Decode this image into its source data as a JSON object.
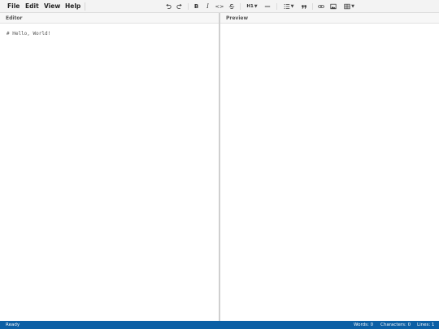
{
  "menu": [
    {
      "label": "File"
    },
    {
      "label": "Edit"
    },
    {
      "label": "View"
    },
    {
      "label": "Help"
    }
  ],
  "toolbar": {
    "bold": "B",
    "italic": "I",
    "code": "<>",
    "heading": "H1",
    "icons": [
      "undo-icon",
      "redo-icon",
      "bold-icon",
      "italic-icon",
      "code-icon",
      "strikethrough-icon",
      "heading-icon",
      "horizontal-rule-icon",
      "list-icon",
      "quote-icon",
      "link-icon",
      "image-icon",
      "table-icon"
    ]
  },
  "panes": {
    "editor_title": "Editor",
    "preview_title": "Preview",
    "editor_content": "# Hello, World!"
  },
  "status": {
    "state": "Ready",
    "words": "Words: 0",
    "characters": "Characters: 0",
    "lines": "Lines: 1"
  },
  "colors": {
    "status_bar": "#0b5fa5",
    "menubar": "#f3f3f3"
  }
}
